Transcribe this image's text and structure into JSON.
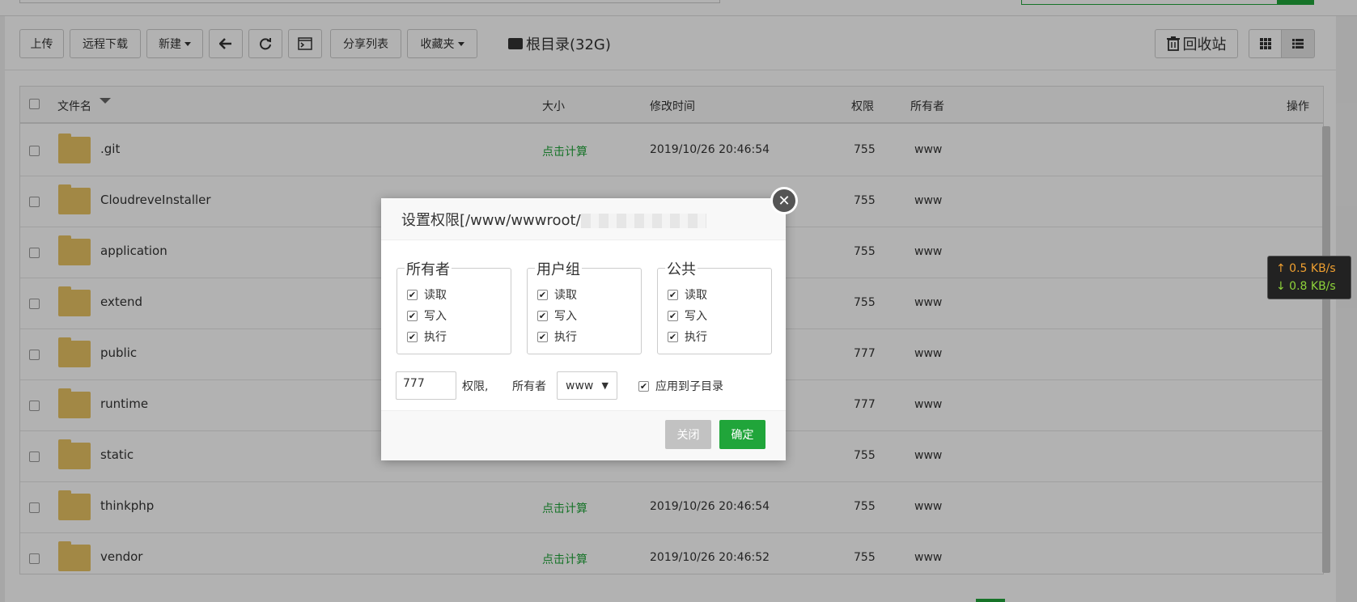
{
  "toolbar": {
    "upload": "上传",
    "remote_download": "远程下载",
    "new": "新建",
    "share_list": "分享列表",
    "favorites": "收藏夹",
    "root_dir": "根目录(32G)",
    "recycle_bin": "回收站"
  },
  "table": {
    "headers": {
      "name": "文件名",
      "size": "大小",
      "mtime": "修改时间",
      "perm": "权限",
      "owner": "所有者",
      "ops": "操作"
    },
    "rows": [
      {
        "name": ".git",
        "size": "点击计算",
        "mtime": "2019/10/26 20:46:54",
        "perm": "755",
        "owner": "www"
      },
      {
        "name": "CloudreveInstaller",
        "perm": "755",
        "owner": "www"
      },
      {
        "name": "application",
        "perm": "755",
        "owner": "www"
      },
      {
        "name": "extend",
        "perm": "755",
        "owner": "www"
      },
      {
        "name": "public",
        "perm": "777",
        "owner": "www"
      },
      {
        "name": "runtime",
        "perm": "777",
        "owner": "www"
      },
      {
        "name": "static",
        "perm": "755",
        "owner": "www"
      },
      {
        "name": "thinkphp",
        "size": "点击计算",
        "mtime": "2019/10/26 20:46:54",
        "perm": "755",
        "owner": "www"
      },
      {
        "name": "vendor",
        "size": "点击计算",
        "mtime": "2019/10/26 20:46:52",
        "perm": "755",
        "owner": "www"
      }
    ]
  },
  "speed": {
    "up": "↑ 0.5 KB/s",
    "down": "↓ 0.8 KB/s"
  },
  "dialog": {
    "title": "设置权限[/www/wwwroot/",
    "groups": [
      {
        "label": "所有者",
        "items": [
          "读取",
          "写入",
          "执行"
        ]
      },
      {
        "label": "用户组",
        "items": [
          "读取",
          "写入",
          "执行"
        ]
      },
      {
        "label": "公共",
        "items": [
          "读取",
          "写入",
          "执行"
        ]
      }
    ],
    "perm_value": "777",
    "perm_label": "权限,",
    "owner_label": "所有者",
    "owner_value": "www",
    "apply_subdir": "应用到子目录",
    "close": "关闭",
    "confirm": "确定"
  },
  "colors": {
    "accent": "#20a53a",
    "folder": "#e8c364"
  }
}
